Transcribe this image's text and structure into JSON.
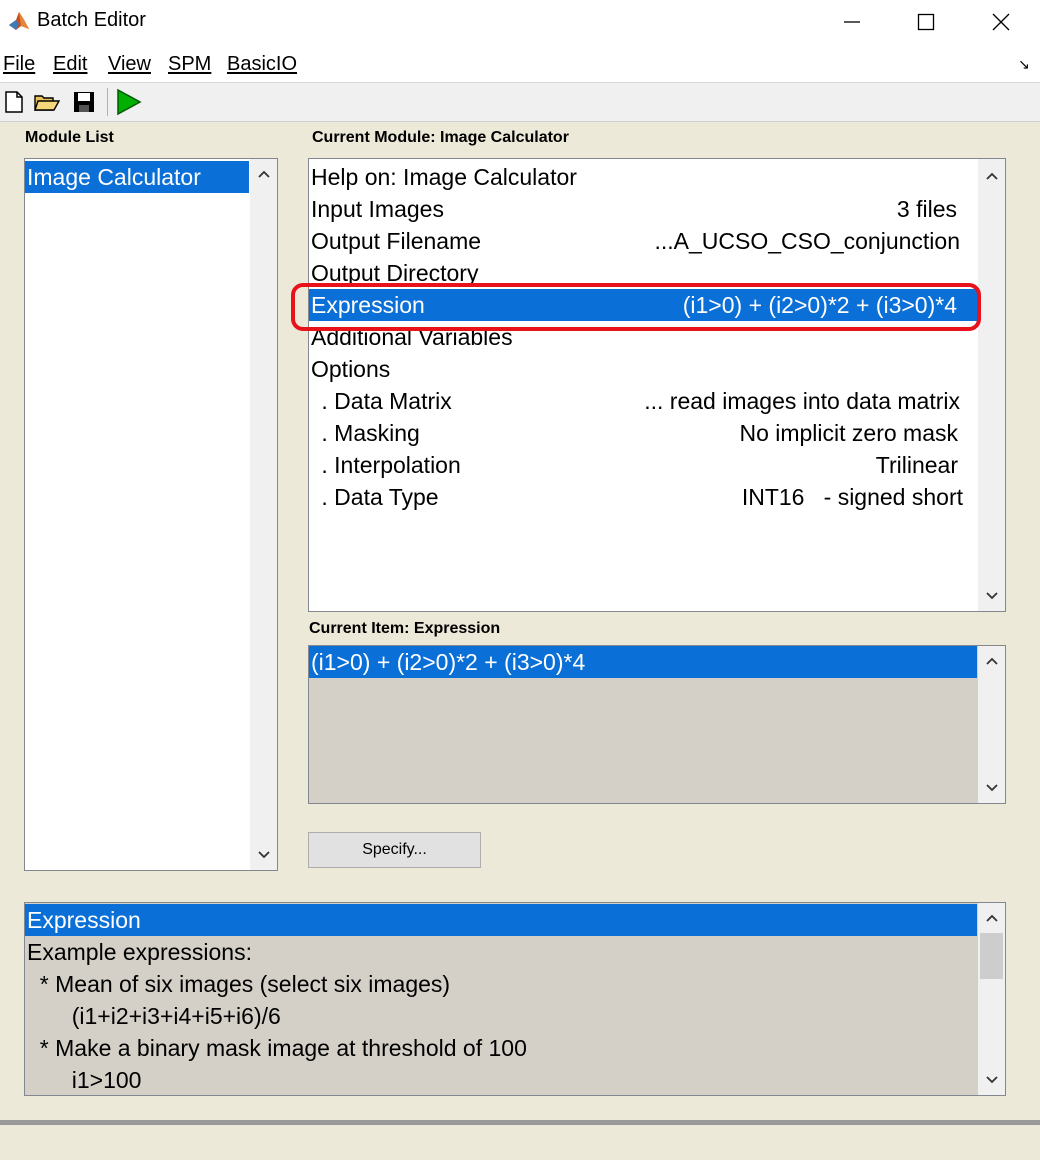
{
  "window": {
    "title": "Batch Editor",
    "icon": "matlab-icon",
    "controls": [
      "minimize-icon",
      "maximize-icon",
      "close-icon"
    ]
  },
  "menu": {
    "items": [
      "File",
      "Edit",
      "View",
      "SPM",
      "BasicIO"
    ],
    "expand_glyph": "↘"
  },
  "toolbar": {
    "buttons": [
      "new-file-icon",
      "open-folder-icon",
      "save-icon",
      "run-icon"
    ],
    "run_color": "#00a000"
  },
  "module_list": {
    "label": "Module List",
    "items": [
      "Image Calculator"
    ],
    "selected_index": 0
  },
  "current_module": {
    "label": "Current Module: Image Calculator",
    "rows": [
      {
        "label": "Help on: Image Calculator",
        "value": ""
      },
      {
        "label": "Input Images",
        "value": "3 files"
      },
      {
        "label": "Output Filename",
        "value": "...A_UCSO_CSO_conjunction"
      },
      {
        "label": "Output Directory",
        "value": ""
      },
      {
        "label": "Expression",
        "value": "(i1>0) + (i2>0)*2 + (i3>0)*4"
      },
      {
        "label": "Additional Variables",
        "value": ""
      },
      {
        "label": "Options",
        "value": ""
      },
      {
        "label": " . Data Matrix",
        "value": "... read images into data matrix"
      },
      {
        "label": " . Masking",
        "value": "No implicit zero mask"
      },
      {
        "label": " . Interpolation",
        "value": "Trilinear"
      },
      {
        "label": " . Data Type",
        "value": "INT16   - signed short"
      }
    ],
    "selected_index": 4
  },
  "current_item": {
    "label": "Current Item: Expression",
    "value": "(i1>0) + (i2>0)*2 + (i3>0)*4"
  },
  "specify_button": "Specify...",
  "help": {
    "lines": [
      "Expression",
      "Example expressions:",
      "  * Mean of six images (select six images)",
      "       (i1+i2+i3+i4+i5+i6)/6",
      "  * Make a binary mask image at threshold of 100",
      "       i1>100"
    ],
    "selected_index": 0
  },
  "colors": {
    "selection": "#0a6fd6",
    "highlight_outline": "#e8121b",
    "window_bg": "#ece9d8"
  }
}
